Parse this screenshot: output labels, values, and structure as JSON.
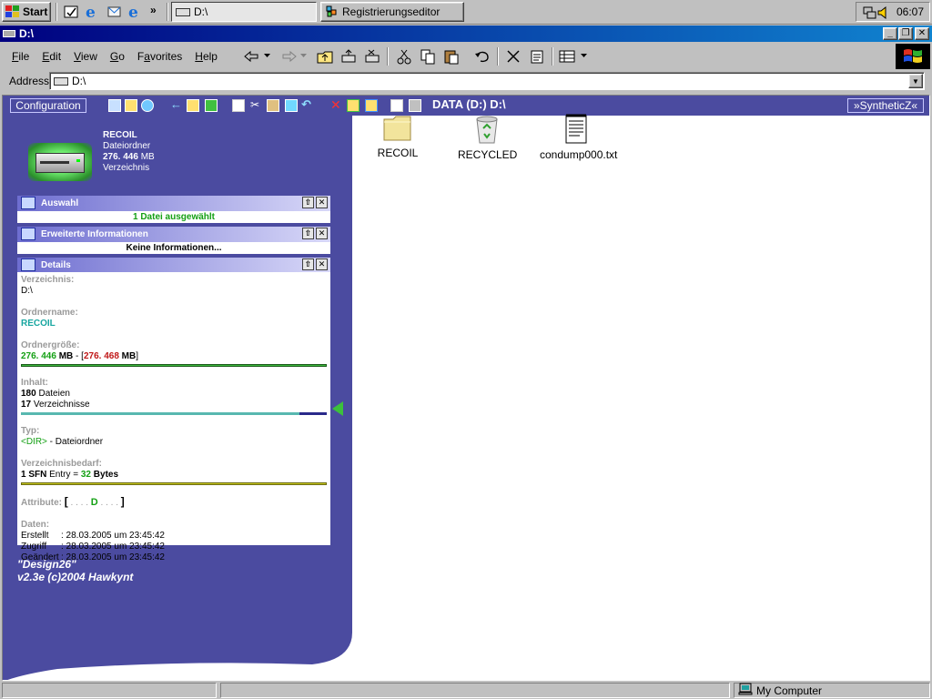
{
  "taskbar": {
    "start_label": "Start",
    "tasks": [
      {
        "label": "D:\\",
        "active": true
      },
      {
        "label": "Registrierungseditor",
        "active": false
      }
    ],
    "clock": "06:07",
    "quick_launch_more": "»"
  },
  "window": {
    "title": "D:\\"
  },
  "menu": {
    "items": [
      "File",
      "Edit",
      "View",
      "Go",
      "Favorites",
      "Help"
    ],
    "underlines": [
      "F",
      "E",
      "V",
      "G",
      "a",
      "H"
    ]
  },
  "address": {
    "label": "Address",
    "value": "D:\\"
  },
  "webview": {
    "config_label": "Configuration",
    "drive_label": "DATA (D:)  D:\\",
    "synthetic_label": "»SyntheticZ«",
    "folder": {
      "name": "RECOIL",
      "type": "Dateiordner",
      "size_value": "276. 446",
      "size_unit": "MB",
      "kind": "Verzeichnis"
    },
    "auswahl": {
      "title": "Auswahl",
      "text": "1 Datei ausgewählt"
    },
    "erweitert": {
      "title": "Erweiterte Informationen",
      "text": "Keine Informationen..."
    },
    "details": {
      "title": "Details",
      "verzeichnis_label": "Verzeichnis:",
      "verzeichnis_value": "D:\\",
      "ordnername_label": "Ordnername:",
      "ordnername_value": "RECOIL",
      "groesse_label": "Ordnergröße:",
      "groesse_value": "276. 446",
      "groesse_unit": "MB",
      "groesse_sep": " - [",
      "groesse_total": "276. 468",
      "groesse_total_unit": "MB",
      "groesse_close": "]",
      "size_fraction": 0.9999,
      "inhalt_label": "Inhalt:",
      "dateien_count": "180",
      "dateien_label": "Dateien",
      "verz_count": "17",
      "verz_label": "Verzeichnisse",
      "content_fraction": 0.91,
      "typ_label": "Typ:",
      "typ_dir": "<DIR>",
      "typ_desc": " - Dateiordner",
      "bedarf_label": "Verzeichnisbedarf:",
      "sfn_count": "1",
      "sfn_text": "SFN",
      "entry_text": "Entry",
      "equals": "=",
      "bytes_count": "32",
      "bytes_label": "Bytes",
      "attribute_label": "Attribute:",
      "attribute_open": "[",
      "attribute_pre": " . . . . ",
      "attribute_d": "D",
      "attribute_post": " . . . . ",
      "attribute_close": "]",
      "daten_label": "Daten:",
      "erstellt_label": "Erstellt",
      "zugriff_label": "Zugriff",
      "geaendert_label": "Geändert",
      "date_value": ": 28.03.2005 um 23:45:42"
    },
    "design_line1": "\"Design26\"",
    "design_line2": "v2.3e (c)2004 Hawkynt"
  },
  "files": [
    {
      "name": "RECOIL",
      "icon": "folder-icon"
    },
    {
      "name": "RECYCLED",
      "icon": "recycle-bin-icon"
    },
    {
      "name": "condump000.txt",
      "icon": "text-file-icon"
    }
  ],
  "status": {
    "zone": "My Computer"
  },
  "colors": {
    "panel_purple": "#4b4ba0",
    "title_blue": "#000080",
    "accent_green": "#14a014",
    "accent_red": "#c01818"
  }
}
